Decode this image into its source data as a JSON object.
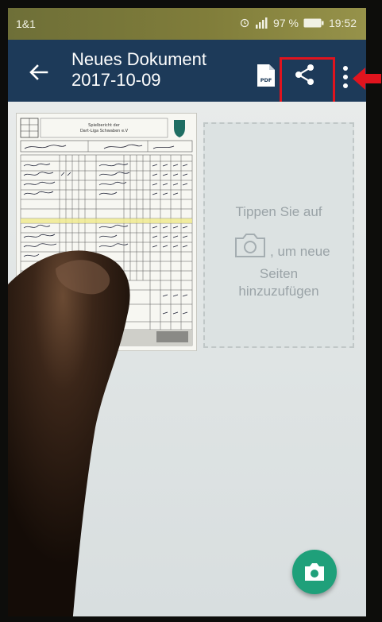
{
  "status_bar": {
    "carrier": "1&1",
    "battery": "97 %",
    "time": "19:52"
  },
  "app_bar": {
    "title_line1": "Neues Dokument",
    "title_line2": "2017-10-09",
    "icons": [
      "arrow-back-icon",
      "pdf-icon",
      "share-icon",
      "more-vertical-icon"
    ],
    "color": "#1d3a59"
  },
  "document": {
    "header_line1": "Spielbericht der",
    "header_line2": "Dart-Liga Schwaben e.V"
  },
  "add_page": {
    "line1": "Tippen Sie auf",
    "line2": ", um neue",
    "line3": "Seiten",
    "line4": "hinzuzufügen"
  },
  "fab": {
    "icon": "camera-icon",
    "color": "#1fa07a"
  },
  "annotation": {
    "highlight_color": "#e0141e"
  }
}
